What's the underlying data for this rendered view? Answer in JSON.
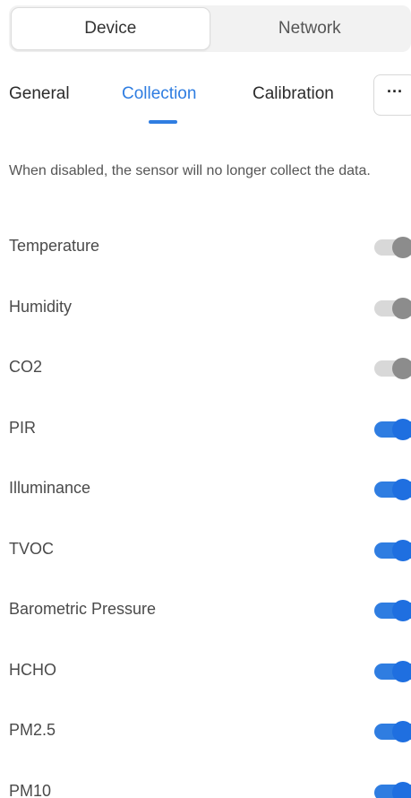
{
  "segmented": {
    "device_label": "Device",
    "network_label": "Network",
    "selected": "Device"
  },
  "tabs": {
    "general_label": "General",
    "collection_label": "Collection",
    "calibration_label": "Calibration",
    "more_label": "···",
    "active": "Collection"
  },
  "description": "When disabled, the sensor will no longer collect the data.",
  "colors": {
    "accent": "#2f7de1",
    "toggle_off_knob": "#8c8c8c",
    "toggle_off_track": "#d8d8d8"
  },
  "items": [
    {
      "label": "Temperature",
      "enabled": false
    },
    {
      "label": "Humidity",
      "enabled": false
    },
    {
      "label": "CO2",
      "enabled": false
    },
    {
      "label": "PIR",
      "enabled": true
    },
    {
      "label": "Illuminance",
      "enabled": true
    },
    {
      "label": "TVOC",
      "enabled": true
    },
    {
      "label": "Barometric Pressure",
      "enabled": true
    },
    {
      "label": "HCHO",
      "enabled": true
    },
    {
      "label": "PM2.5",
      "enabled": true
    },
    {
      "label": "PM10",
      "enabled": true
    }
  ]
}
